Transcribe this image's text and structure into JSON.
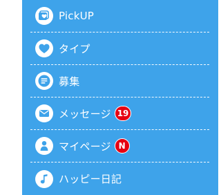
{
  "colors": {
    "panel_bg": "#3ea3ea",
    "divider": "#ffffff",
    "label": "#ffffff",
    "badge_bg": "#e60012"
  },
  "menu": {
    "items": [
      {
        "label": "PickUP",
        "icon": "photo-heart-icon"
      },
      {
        "label": "タイプ",
        "icon": "heart-icon"
      },
      {
        "label": "募集",
        "icon": "lines-icon"
      },
      {
        "label": "メッセージ",
        "icon": "envelope-icon",
        "badge": "19"
      },
      {
        "label": "マイページ",
        "icon": "person-icon",
        "badge": "N"
      },
      {
        "label": "ハッピー日記",
        "icon": "music-note-icon"
      }
    ]
  }
}
